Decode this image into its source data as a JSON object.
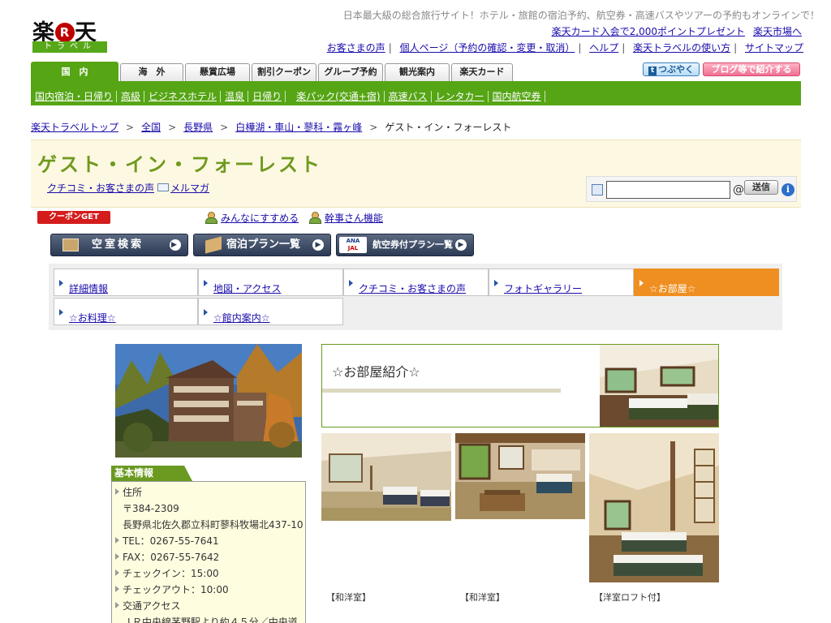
{
  "logo": {
    "main_left": "楽",
    "main_r": "R",
    "main_right": "天",
    "sub": "トラベル"
  },
  "header": {
    "tagline": "日本最大級の総合旅行サイト！ホテル・旅館の宿泊予約、航空券・高速バスやツアーの予約もオンラインで！",
    "promo": [
      "楽天カード入会で2,000ポイントプレゼント",
      "楽天市場へ"
    ],
    "links": [
      "お客さまの声",
      "個人ページ（予約の確認・変更・取消）",
      "ヘルプ",
      "楽天トラベルの使い方",
      "サイトマップ"
    ]
  },
  "tabs": [
    "国　内",
    "海　外",
    "懸賞広場",
    "割引クーポン",
    "グループ予約",
    "観光案内",
    "楽天カード"
  ],
  "social": {
    "tweet": "つぶやく",
    "blog": "ブログ等で紹介する"
  },
  "subnav": [
    "国内宿泊・日帰り",
    "高級",
    "ビジネスホテル",
    "温泉",
    "日帰り",
    "楽パック(交通+宿)",
    "高速バス",
    "レンタカー",
    "国内航空券"
  ],
  "breadcrumb": [
    "楽天トラベルトップ",
    "全国",
    "長野県",
    "白樺湖・車山・蓼科・霧ヶ峰"
  ],
  "breadcrumb_current": "ゲスト・イン・フォーレスト",
  "breadcrumb_sep": ">",
  "hotel": {
    "name": "ゲスト・イン・フォーレスト",
    "reviews_link": "クチコミ・お客さまの声",
    "mailmag_link": "メルマガ"
  },
  "search": {
    "at": "@",
    "send": "送信",
    "info": "i"
  },
  "coupon": "クーポンGET",
  "recommend": {
    "share": "みんなにすすめる",
    "organizer": "幹事さん機能"
  },
  "buttons": {
    "vacancy": "空室検索",
    "plans": "宿泊プラン一覧",
    "flight": "航空券付プラン一覧",
    "flight_logo_top": "ANA",
    "flight_logo_bottom": "JAL"
  },
  "nav": [
    "詳細情報",
    "地図・アクセス",
    "クチコミ・お客さまの声",
    "フォトギャラリー",
    "☆お部屋☆",
    "☆お料理☆",
    "☆館内案内☆"
  ],
  "nav_active": 4,
  "info": {
    "heading": "基本情報",
    "address_label": "住所",
    "postal": "〒384-2309",
    "address": "長野県北佐久郡立科町蓼科牧場北437-10",
    "tel": "TEL：0267-55-7641",
    "fax": "FAX：0267-55-7642",
    "checkin": "チェックイン：15:00",
    "checkout": "チェックアウト：10:00",
    "access_label": "交通アクセス",
    "access": "ＪＲ中央線茅野駅より約４５分／中央道"
  },
  "rooms": {
    "title": "☆お部屋紹介☆",
    "captions": [
      "【和洋室】",
      "【和洋室】",
      "【洋室ロフト付】"
    ]
  }
}
